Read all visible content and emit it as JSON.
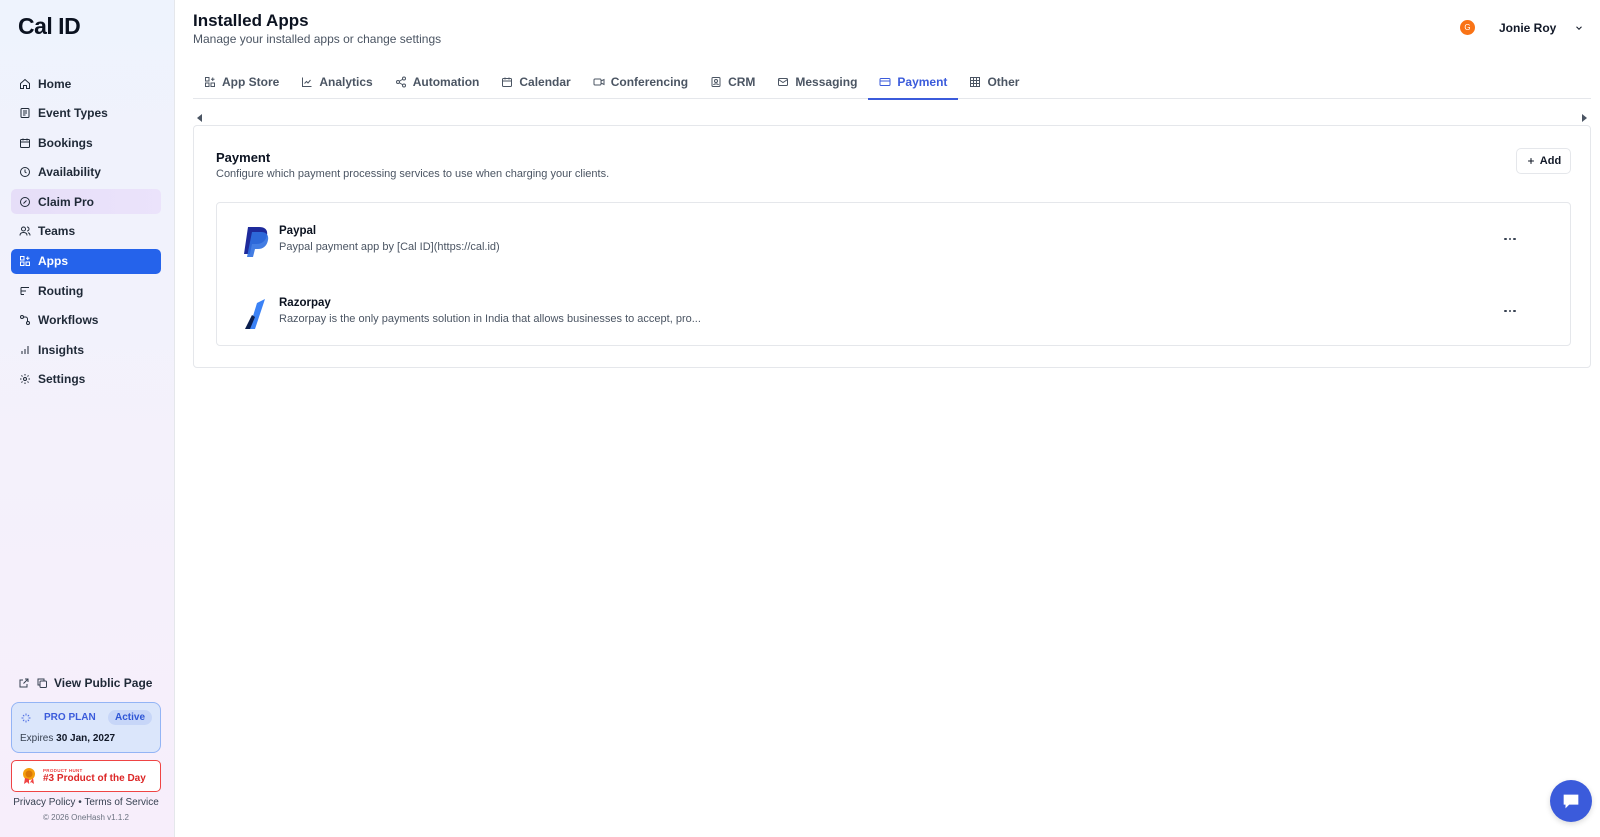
{
  "brand": {
    "logo_text": "Cal ID"
  },
  "sidebar": {
    "items": [
      {
        "label": "Home",
        "icon": "home-icon"
      },
      {
        "label": "Event Types",
        "icon": "link-icon"
      },
      {
        "label": "Bookings",
        "icon": "calendar-icon"
      },
      {
        "label": "Availability",
        "icon": "clock-icon"
      },
      {
        "label": "Claim Pro",
        "icon": "badge-icon"
      },
      {
        "label": "Teams",
        "icon": "users-icon"
      },
      {
        "label": "Apps",
        "icon": "grid-plus-icon"
      },
      {
        "label": "Routing",
        "icon": "routing-icon"
      },
      {
        "label": "Workflows",
        "icon": "workflow-icon"
      },
      {
        "label": "Insights",
        "icon": "bar-chart-icon"
      },
      {
        "label": "Settings",
        "icon": "gear-icon"
      }
    ],
    "active_item": "Apps",
    "public_page_label": "View Public Page",
    "plan": {
      "name": "PRO PLAN",
      "status": "Active",
      "expires_prefix": "Expires",
      "expires_date": "30 Jan, 2027"
    },
    "product_hunt": {
      "small": "PRODUCT HUNT",
      "big": "#3 Product of the Day"
    },
    "legal": {
      "privacy": "Privacy Policy",
      "separator": "•",
      "terms": "Terms of Service"
    },
    "copyright": "© 2026 OneHash v1.1.2"
  },
  "header": {
    "title": "Installed Apps",
    "subtitle": "Manage your installed apps or change settings",
    "user": {
      "initial": "G",
      "name": "Jonie Roy"
    }
  },
  "tabs": [
    {
      "label": "App Store",
      "icon": "grid-plus-icon"
    },
    {
      "label": "Analytics",
      "icon": "line-chart-icon"
    },
    {
      "label": "Automation",
      "icon": "share-icon"
    },
    {
      "label": "Calendar",
      "icon": "calendar-icon"
    },
    {
      "label": "Conferencing",
      "icon": "video-icon"
    },
    {
      "label": "CRM",
      "icon": "contact-icon"
    },
    {
      "label": "Messaging",
      "icon": "mail-icon"
    },
    {
      "label": "Payment",
      "icon": "credit-card-icon"
    },
    {
      "label": "Other",
      "icon": "grid-icon"
    }
  ],
  "active_tab": "Payment",
  "section": {
    "title": "Payment",
    "description": "Configure which payment processing services to use when charging your clients.",
    "add_label": "Add",
    "apps": [
      {
        "name": "Paypal",
        "description": "Paypal payment app by [Cal ID](https://cal.id)",
        "icon": "paypal-logo"
      },
      {
        "name": "Razorpay",
        "description": "Razorpay is the only payments solution in India that allows businesses to accept, pro...",
        "icon": "razorpay-logo"
      }
    ]
  },
  "colors": {
    "accent": "#2563eb",
    "tab_active": "#3b5bdb",
    "avatar": "#f97316",
    "product_hunt": "#dc2626"
  }
}
